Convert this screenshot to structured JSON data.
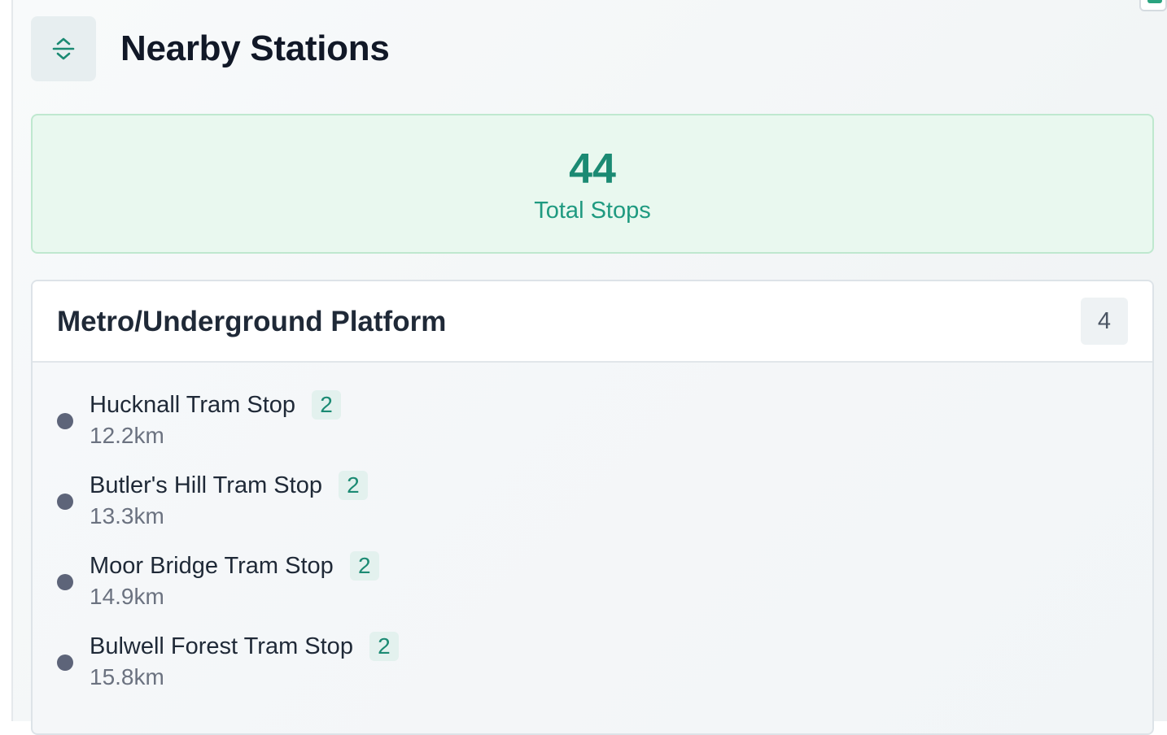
{
  "header": {
    "title": "Nearby Stations",
    "icon": "expand-collapse-icon"
  },
  "summary": {
    "count": "44",
    "label": "Total Stops"
  },
  "group": {
    "title": "Metro/Underground Platform",
    "count": "4",
    "stations": [
      {
        "name": "Hucknall Tram Stop",
        "platforms": "2",
        "distance": "12.2km"
      },
      {
        "name": "Butler's Hill Tram Stop",
        "platforms": "2",
        "distance": "13.3km"
      },
      {
        "name": "Moor Bridge Tram Stop",
        "platforms": "2",
        "distance": "14.9km"
      },
      {
        "name": "Bulwell Forest Tram Stop",
        "platforms": "2",
        "distance": "15.8km"
      }
    ]
  },
  "colors": {
    "accent": "#1b8a73",
    "summary_bg": "#e9f8ef",
    "dot": "#5d6479"
  }
}
